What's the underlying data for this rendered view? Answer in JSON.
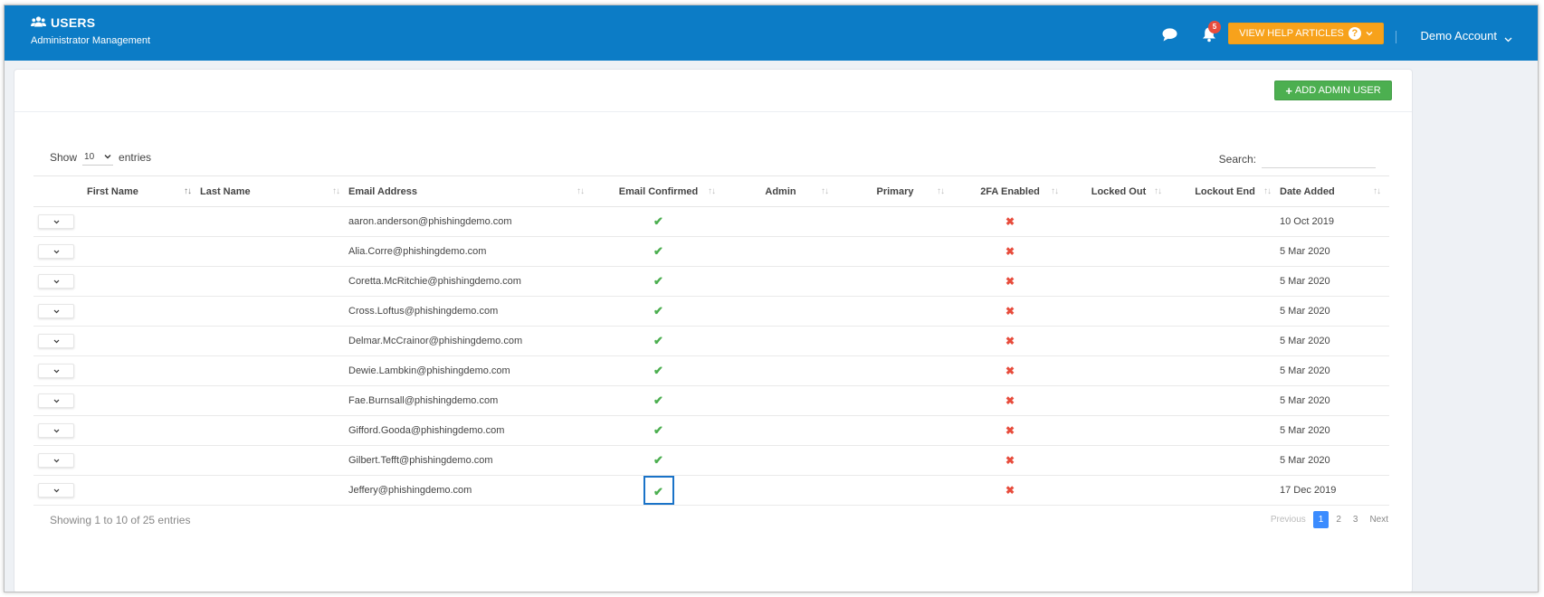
{
  "header": {
    "title": "USERS",
    "subtitle": "Administrator Management",
    "notification_count": "5",
    "help_label": "VIEW HELP ARTICLES",
    "account_name": "Demo Account",
    "brand_color": "#0c7cc6",
    "help_color": "#f7a21b"
  },
  "panel": {
    "add_button_label": "ADD ADMIN USER",
    "add_button_color": "#4caf50"
  },
  "controls": {
    "show_label": "Show",
    "page_length": "10",
    "entries_label": "entries",
    "search_label": "Search:",
    "search_value": ""
  },
  "table": {
    "columns": [
      "First Name",
      "Last Name",
      "Email Address",
      "Email Confirmed",
      "Admin",
      "Primary",
      "2FA Enabled",
      "Locked Out",
      "Lockout End",
      "Date Added"
    ],
    "rows": [
      {
        "email": "aaron.anderson@phishingdemo.com",
        "confirmed": "✔",
        "twofa": "✖",
        "date": "10 Oct 2019"
      },
      {
        "email": "Alia.Corre@phishingdemo.com",
        "confirmed": "✔",
        "twofa": "✖",
        "date": "5 Mar 2020"
      },
      {
        "email": "Coretta.McRitchie@phishingdemo.com",
        "confirmed": "✔",
        "twofa": "✖",
        "date": "5 Mar 2020"
      },
      {
        "email": "Cross.Loftus@phishingdemo.com",
        "confirmed": "✔",
        "twofa": "✖",
        "date": "5 Mar 2020"
      },
      {
        "email": "Delmar.McCrainor@phishingdemo.com",
        "confirmed": "✔",
        "twofa": "✖",
        "date": "5 Mar 2020"
      },
      {
        "email": "Dewie.Lambkin@phishingdemo.com",
        "confirmed": "✔",
        "twofa": "✖",
        "date": "5 Mar 2020"
      },
      {
        "email": "Fae.Burnsall@phishingdemo.com",
        "confirmed": "✔",
        "twofa": "✖",
        "date": "5 Mar 2020"
      },
      {
        "email": "Gifford.Gooda@phishingdemo.com",
        "confirmed": "✔",
        "twofa": "✖",
        "date": "5 Mar 2020"
      },
      {
        "email": "Gilbert.Tefft@phishingdemo.com",
        "confirmed": "✔",
        "twofa": "✖",
        "date": "5 Mar 2020"
      },
      {
        "email": "Jeffery@phishingdemo.com",
        "confirmed": "✔",
        "twofa": "✖",
        "date": "17 Dec 2019"
      }
    ]
  },
  "footer": {
    "info": "Showing 1 to 10 of 25 entries",
    "previous": "Previous",
    "pages": [
      "1",
      "2",
      "3"
    ],
    "next": "Next"
  },
  "icons": {
    "users": "users-icon",
    "chat": "chat-icon",
    "bell": "bell-icon",
    "help": "question-icon",
    "chevron": "chevron-down-icon",
    "plus": "plus-icon",
    "check": "check-icon",
    "cross": "cross-icon"
  }
}
